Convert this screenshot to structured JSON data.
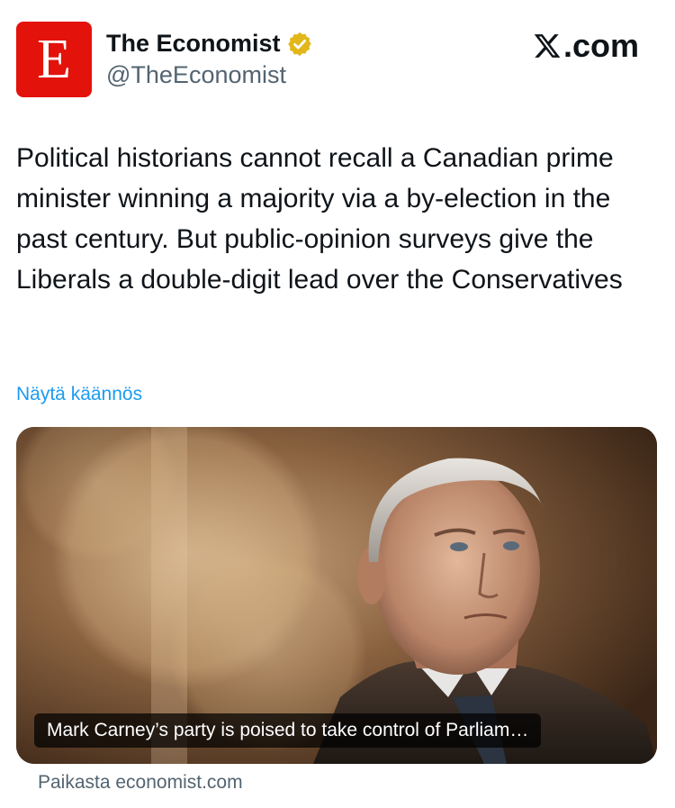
{
  "account": {
    "avatar_letter": "E",
    "display_name": "The Economist",
    "handle": "@TheEconomist",
    "verified_badge": "gold-verified-icon",
    "brand_color": "#e3120b"
  },
  "platform": {
    "brand_text": ".com",
    "logo": "x-logo-icon"
  },
  "tweet": {
    "text": "Political historians cannot recall a Canadian prime minister winning a majority via a by-election in the past century. But public-opinion surveys give the Liberals a double-digit lead over the Conservatives",
    "translate_label": "Näytä käännös"
  },
  "card": {
    "image": "portrait-photo",
    "caption": "Mark Carney’s party is poised to take control of Parliam…",
    "source": "Paikasta economist.com"
  },
  "colors": {
    "link": "#1d9bf0",
    "secondary_text": "#536471",
    "verified_gold": "#e2b719"
  }
}
